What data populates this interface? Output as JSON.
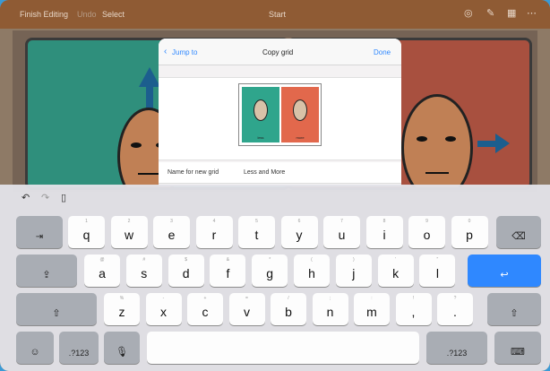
{
  "topbar": {
    "finish_editing": "Finish Editing",
    "undo": "Undo",
    "select": "Select",
    "title": "Start"
  },
  "dialog": {
    "back": "Jump to",
    "title": "Copy grid",
    "done": "Done",
    "preview_left": "less",
    "preview_right": "more",
    "name_label": "Name for new grid",
    "name_value": "Less and More"
  },
  "keyboard": {
    "row1": [
      [
        "1",
        "q"
      ],
      [
        "2",
        "w"
      ],
      [
        "3",
        "e"
      ],
      [
        "4",
        "r"
      ],
      [
        "5",
        "t"
      ],
      [
        "6",
        "y"
      ],
      [
        "7",
        "u"
      ],
      [
        "8",
        "i"
      ],
      [
        "9",
        "o"
      ],
      [
        "0",
        "p"
      ]
    ],
    "row2": [
      [
        "@",
        "a"
      ],
      [
        "#",
        "s"
      ],
      [
        "$",
        "d"
      ],
      [
        "&",
        "f"
      ],
      [
        "*",
        "g"
      ],
      [
        "(",
        "h"
      ],
      [
        ")",
        "j"
      ],
      [
        "'",
        "k"
      ],
      [
        "\"",
        "l"
      ]
    ],
    "row3": [
      [
        "%",
        "z"
      ],
      [
        "-",
        "x"
      ],
      [
        "+",
        "c"
      ],
      [
        "=",
        "v"
      ],
      [
        "/",
        "b"
      ],
      [
        ";",
        "n"
      ],
      [
        ":",
        "m"
      ],
      [
        "!",
        ","
      ],
      [
        "?",
        "."
      ]
    ],
    "numbers_label": ".?123"
  },
  "colors": {
    "accent": "#2f88ff",
    "topbar": "#8f5b34",
    "green_card": "#2f8f7c",
    "red_card": "#a8503f"
  }
}
